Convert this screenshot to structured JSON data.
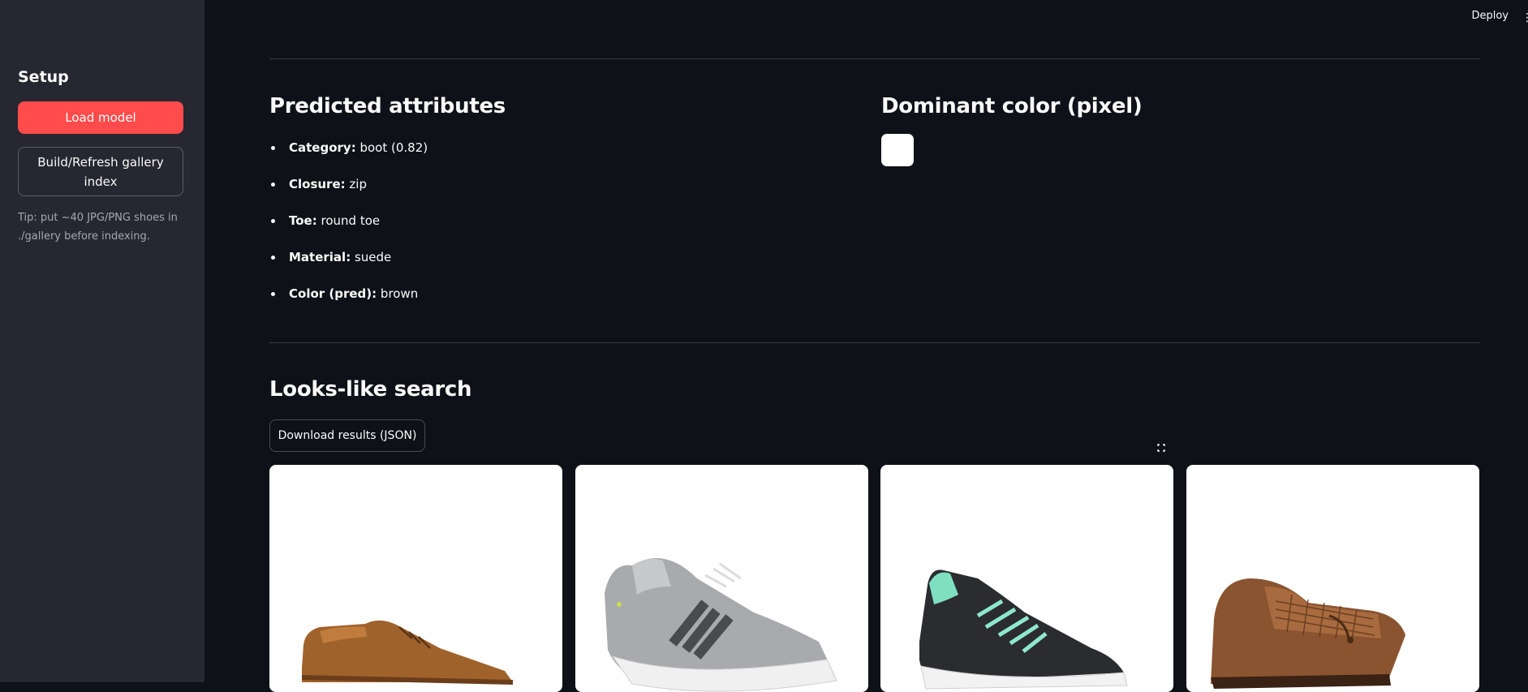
{
  "header": {
    "deploy_label": "Deploy"
  },
  "sidebar": {
    "title": "Setup",
    "load_model_label": "Load model",
    "build_index_label": "Build/Refresh gallery index",
    "tip": "Tip: put ~40 JPG/PNG shoes in ./gallery before indexing."
  },
  "predicted": {
    "title": "Predicted attributes",
    "items": [
      {
        "key": "Category:",
        "value": "boot (0.82)"
      },
      {
        "key": "Closure:",
        "value": "zip"
      },
      {
        "key": "Toe:",
        "value": "round toe"
      },
      {
        "key": "Material:",
        "value": "suede"
      },
      {
        "key": "Color (pred):",
        "value": "brown"
      }
    ]
  },
  "dominant": {
    "title": "Dominant color (pixel)",
    "swatch_color": "#ffffff"
  },
  "search": {
    "title": "Looks-like search",
    "download_label": "Download results (JSON)",
    "results": [
      {
        "icon": "brown-leather-sneaker-image"
      },
      {
        "icon": "grey-running-shoe-image"
      },
      {
        "icon": "black-mint-running-shoe-image"
      },
      {
        "icon": "brown-woven-loafer-image"
      }
    ]
  },
  "colors": {
    "accent": "#ff4b4b",
    "background": "#0e1117",
    "sidebar": "#262730"
  }
}
